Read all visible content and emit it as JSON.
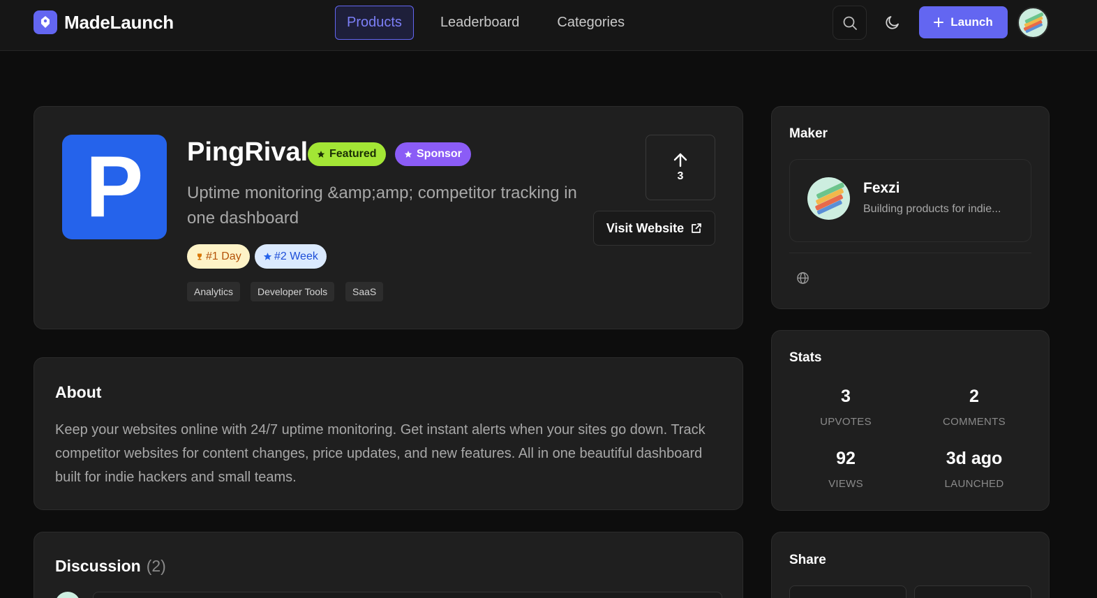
{
  "header": {
    "brand": "MadeLaunch",
    "nav": [
      {
        "label": "Products",
        "active": true
      },
      {
        "label": "Leaderboard",
        "active": false
      },
      {
        "label": "Categories",
        "active": false
      }
    ],
    "launch_label": "Launch",
    "accent_color": "#6366f1"
  },
  "product": {
    "logo_letter": "P",
    "logo_color": "#2563eb",
    "name": "PingRival",
    "badges": {
      "featured": "Featured",
      "sponsor": "Sponsor"
    },
    "tagline": "Uptime monitoring &amp;amp; competitor tracking in one dashboard",
    "ranks": {
      "day": "#1 Day",
      "week": "#2 Week"
    },
    "tags": [
      "Analytics",
      "Developer Tools",
      "SaaS"
    ],
    "upvotes": "3",
    "visit_label": "Visit Website"
  },
  "about": {
    "title": "About",
    "text": "Keep your websites online with 24/7 uptime monitoring. Get instant alerts when your sites go down. Track competitor websites for content changes, price updates, and new features. All in one beautiful dashboard built for indie hackers and small teams."
  },
  "discussion": {
    "title": "Discussion",
    "count": "(2)"
  },
  "maker": {
    "title": "Maker",
    "name": "Fexzi",
    "bio": "Building products for indie..."
  },
  "stats": {
    "title": "Stats",
    "items": [
      {
        "value": "3",
        "label": "UPVOTES"
      },
      {
        "value": "2",
        "label": "COMMENTS"
      },
      {
        "value": "92",
        "label": "VIEWS"
      },
      {
        "value": "3d ago",
        "label": "LAUNCHED"
      }
    ]
  },
  "share": {
    "title": "Share"
  }
}
